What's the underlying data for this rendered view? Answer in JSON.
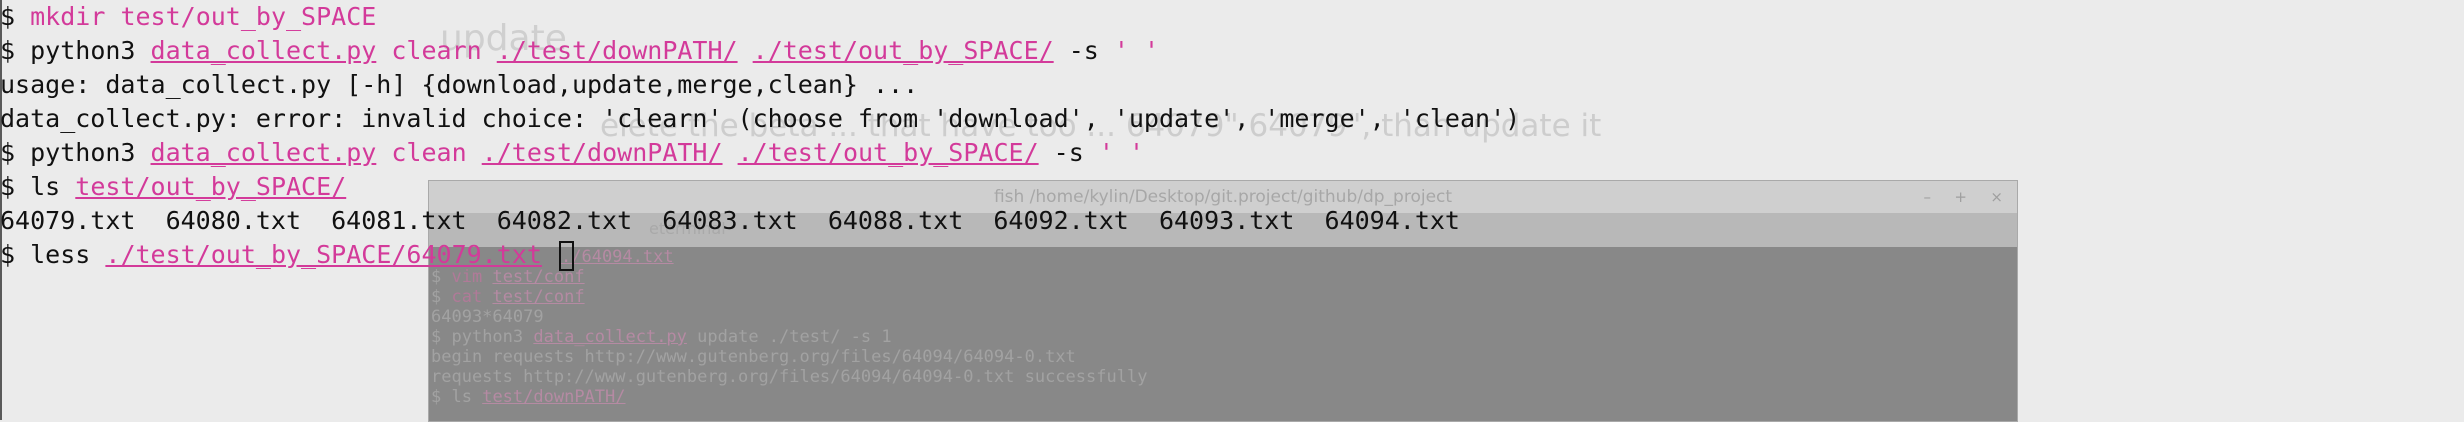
{
  "background": {
    "doc_title": "update",
    "doc_line": "elete the beta ... that have too ... 64079\" 64079\", than update it",
    "window_title": "fish /home/kylin/Desktop/git.project/github/dp_project",
    "window_controls": [
      "–",
      "+",
      "×"
    ],
    "tab_text": "eterminal",
    "lines": [
      {
        "prompt": "",
        "text": "",
        "path": "./64094.txt"
      },
      {
        "prompt": "$ ",
        "cmd": "vim",
        "text": " ",
        "path": "test/conf"
      },
      {
        "prompt": "$ ",
        "cmd": "cat",
        "text": " ",
        "path": "test/conf"
      },
      {
        "prompt": "",
        "text": "64093*64079",
        "path": ""
      },
      {
        "prompt": "$ ",
        "text": "python3 ",
        "path": "data_collect.py",
        "rest": " update ./test/ -s 1"
      },
      {
        "prompt": "",
        "text": "begin requests http://www.gutenberg.org/files/64094/64094-0.txt",
        "path": ""
      },
      {
        "prompt": "",
        "text": "requests http://www.gutenberg.org/files/64094/64094-0.txt successfully",
        "path": ""
      },
      {
        "prompt": "$ ",
        "text": "ls ",
        "path": "test/downPATH/"
      }
    ]
  },
  "terminal": {
    "lines": [
      {
        "prompt": "$ ",
        "cmd": "mkdir",
        "text1": " ",
        "path1": "test/out_by_SPACE"
      },
      {
        "prompt": "$ ",
        "text0": "python3 ",
        "path0": "data_collect.py",
        "sp1": " ",
        "arg": "clearn",
        "sp2": " ",
        "path1": "./test/downPATH/",
        "sp3": " ",
        "path2": "./test/out_by_SPACE/",
        "opt": " -s ",
        "str": "' '"
      },
      {
        "text": "usage: data_collect.py [-h] {download,update,merge,clean} ..."
      },
      {
        "text": "data_collect.py: error: invalid choice: 'clearn' (choose from 'download', 'update', 'merge', 'clean')"
      },
      {
        "prompt": "$ ",
        "text0": "python3 ",
        "path0": "data_collect.py",
        "sp1": " ",
        "arg": "clean",
        "sp2": " ",
        "path1": "./test/downPATH/",
        "sp3": " ",
        "path2": "./test/out_by_SPACE/",
        "opt": " -s ",
        "str": "' '"
      },
      {
        "prompt": "$ ",
        "cmd": "ls",
        "text1": " ",
        "path1": "test/out_by_SPACE/"
      },
      {
        "text": "64079.txt  64080.txt  64081.txt  64082.txt  64083.txt  64088.txt  64092.txt  64093.txt  64094.txt"
      },
      {
        "prompt": "$ ",
        "cmd": "less",
        "text1": " ",
        "path1": "./test/out_by_SPACE/64079.txt",
        "tail": " "
      }
    ]
  },
  "colors": {
    "highlight": "#d33a9a",
    "text": "#111111",
    "background": "#ebebeb"
  }
}
